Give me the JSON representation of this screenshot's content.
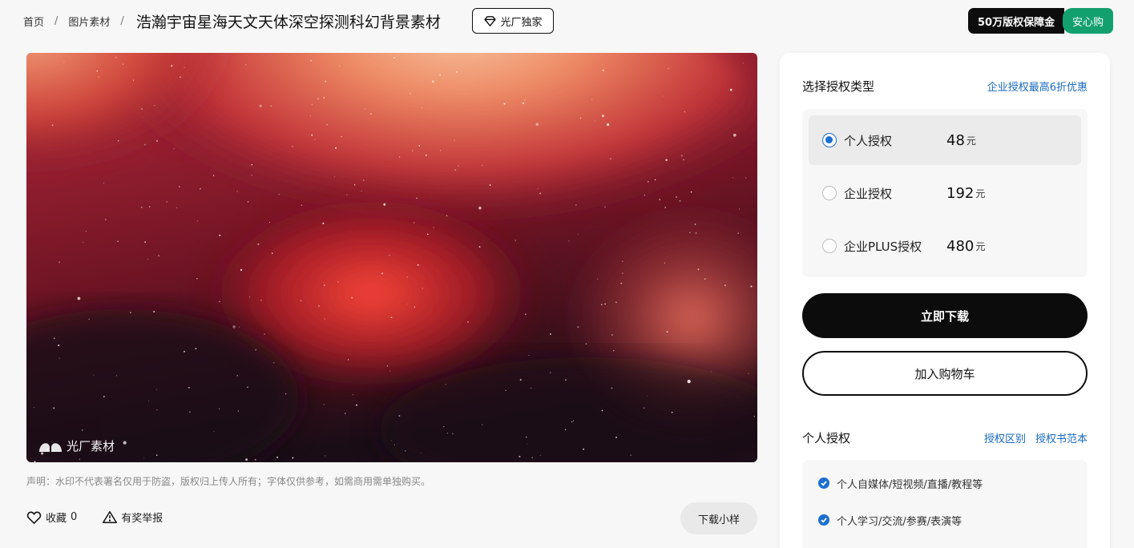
{
  "breadcrumb": {
    "home": "首页",
    "category": "图片素材",
    "separator": "/",
    "title": "浩瀚宇宙星海天文天体深空探测科幻背景素材"
  },
  "exclusive_badge": "光厂独家",
  "guarantee": {
    "amount_label": "50万版权保障金",
    "tag": "安心购"
  },
  "image": {
    "watermark": "光厂素材"
  },
  "notice": "声明：水印不代表署名仅用于防盗，版权归上传人所有；字体仅供参考，如需商用需单独购买。",
  "actions": {
    "favorite_label": "收藏",
    "favorite_count": "0",
    "report_label": "有奖举报",
    "sample_label": "下载小样"
  },
  "license_panel": {
    "title": "选择授权类型",
    "promo_link": "企业授权最高6折优惠",
    "options": [
      {
        "name": "个人授权",
        "price": "48",
        "unit": "元",
        "selected": true
      },
      {
        "name": "企业授权",
        "price": "192",
        "unit": "元",
        "selected": false
      },
      {
        "name": "企业PLUS授权",
        "price": "480",
        "unit": "元",
        "selected": false
      }
    ],
    "download_label": "立即下载",
    "cart_label": "加入购物车"
  },
  "personal_license": {
    "title": "个人授权",
    "links": [
      "授权区别",
      "授权书范本"
    ],
    "features": [
      "个人自媒体/短视频/直播/教程等",
      "个人学习/交流/参赛/表演等"
    ]
  },
  "colors": {
    "accent": "#1a6fd1",
    "link": "#1769c2",
    "safe_green": "#13a06f",
    "primary_button": "#0c0c0c"
  }
}
